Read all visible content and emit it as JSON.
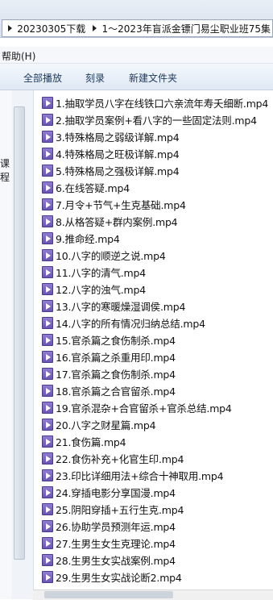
{
  "address": {
    "crumbs": [
      "20230305下载",
      "1～2023年盲派金镖门易尘职业班75集"
    ]
  },
  "menu": {
    "help_label": "帮助(H)"
  },
  "toolbar": {
    "play_all": "全部播放",
    "burn": "刻录",
    "new_folder": "新建文件夹"
  },
  "left_pane": {
    "label": "课程"
  },
  "files": [
    {
      "name": "1.抽取学员八字在线铁口六亲流年寿夭细断.mp4",
      "icon": "video-file-icon"
    },
    {
      "name": "2.抽取学员案例+看八字的一些固定法则.mp4",
      "icon": "video-file-icon"
    },
    {
      "name": "3.特殊格局之弱级详解.mp4",
      "icon": "video-file-icon"
    },
    {
      "name": "4.特殊格局之旺极详解.mp4",
      "icon": "video-file-icon"
    },
    {
      "name": "5.特殊格局之强极详解.mp4",
      "icon": "video-file-icon"
    },
    {
      "name": "6.在线答疑.mp4",
      "icon": "video-file-icon"
    },
    {
      "name": "7.月令+节气+生克基础.mp4",
      "icon": "video-file-icon"
    },
    {
      "name": "8.从格答疑+群内案例.mp4",
      "icon": "video-file-icon"
    },
    {
      "name": "9.推命经.mp4",
      "icon": "video-file-icon"
    },
    {
      "name": "10.八字的顺逆之说.mp4",
      "icon": "video-file-icon"
    },
    {
      "name": "11.八字的清气.mp4",
      "icon": "video-file-icon"
    },
    {
      "name": "12.八字的浊气.mp4",
      "icon": "video-file-icon"
    },
    {
      "name": "13.八字的寒暖燥湿调侯.mp4",
      "icon": "video-file-icon"
    },
    {
      "name": "14.八字的所有情况归纳总结.mp4",
      "icon": "video-file-icon"
    },
    {
      "name": "15.官杀篇之食伤制杀.mp4",
      "icon": "video-file-icon"
    },
    {
      "name": "16.官杀篇之杀重用印.mp4",
      "icon": "video-file-icon"
    },
    {
      "name": "17.官杀篇之食伤制杀.mp4",
      "icon": "video-file-icon"
    },
    {
      "name": "18.官杀篇之合官留杀.mp4",
      "icon": "video-file-icon"
    },
    {
      "name": "19.官杀混杂+合官留杀+官杀总结.mp4",
      "icon": "video-file-icon"
    },
    {
      "name": "20.八字之财星篇.mp4",
      "icon": "video-file-icon"
    },
    {
      "name": "21.食伤篇.mp4",
      "icon": "video-file-icon"
    },
    {
      "name": "22.食伤补充+化官生印.mp4",
      "icon": "video-file-icon"
    },
    {
      "name": "23.印比详细用法+综合十神取用.mp4",
      "icon": "video-file-icon"
    },
    {
      "name": "24.穿插电影分享国漫.mp4",
      "icon": "video-file-icon"
    },
    {
      "name": "25.阴阳穿插+五行生克.mp4",
      "icon": "video-file-icon"
    },
    {
      "name": "26.协助学员预测年运.mp4",
      "icon": "video-file-icon"
    },
    {
      "name": "27.生男生女生克理论.mp4",
      "icon": "video-file-icon"
    },
    {
      "name": "28.生男生女实战案例.mp4",
      "icon": "video-file-icon"
    },
    {
      "name": "29.生男生女实战论断2.mp4",
      "icon": "video-file-icon"
    }
  ]
}
